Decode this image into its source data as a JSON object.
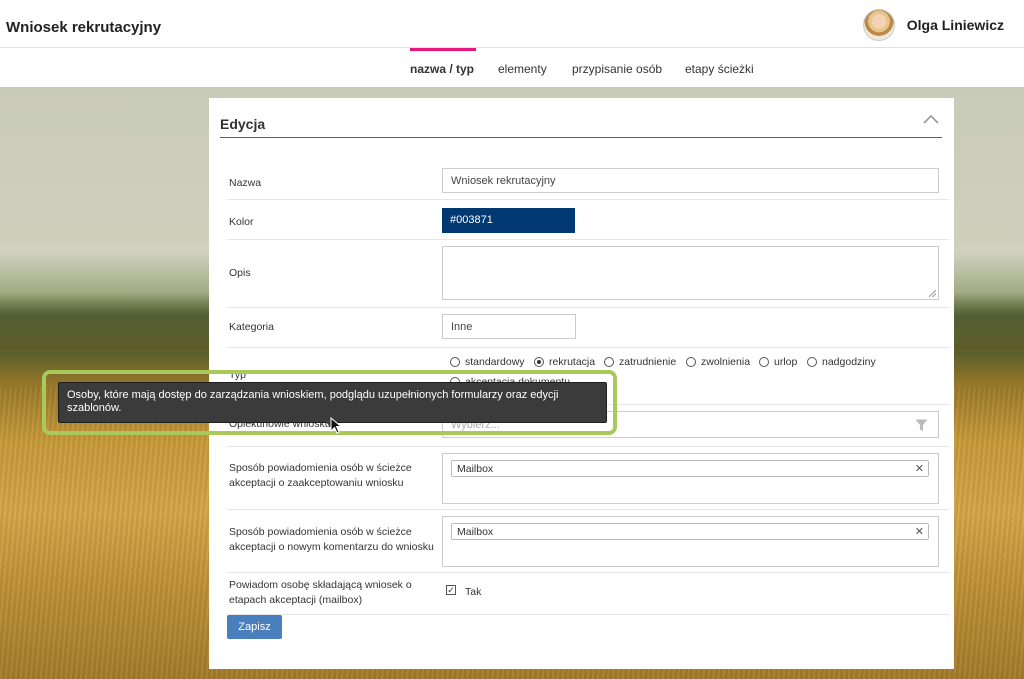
{
  "app": {
    "title": "Wniosek rekrutacyjny"
  },
  "user": {
    "name": "Olga Liniewicz"
  },
  "tabs": [
    {
      "label": "nazwa / typ",
      "active": true
    },
    {
      "label": "elementy",
      "active": false
    },
    {
      "label": "przypisanie osób",
      "active": false
    },
    {
      "label": "etapy ścieżki",
      "active": false
    }
  ],
  "card": {
    "title": "Edycja"
  },
  "form": {
    "name": {
      "label": "Nazwa",
      "value": "Wniosek rekrutacyjny"
    },
    "color": {
      "label": "Kolor",
      "value": "#003871"
    },
    "description": {
      "label": "Opis",
      "value": ""
    },
    "category": {
      "label": "Kategoria",
      "value": "Inne"
    },
    "type": {
      "label": "Typ",
      "options": [
        "standardowy",
        "rekrutacja",
        "zatrudnienie",
        "zwolnienia",
        "urlop",
        "nadgodziny",
        "akceptacja dokumentu"
      ],
      "selected": "rekrutacja"
    },
    "guardians": {
      "label": "Opiekunowie wniosku",
      "placeholder": "Wybierz..."
    },
    "notify_accept": {
      "label": "Sposób powiadomienia osób w ścieżce akceptacji o zaakceptowaniu wniosku",
      "tag": "Mailbox"
    },
    "notify_comment": {
      "label": "Sposób powiadomienia osób w ścieżce akceptacji o nowym komentarzu do wniosku",
      "tag": "Mailbox"
    },
    "notify_applicant": {
      "label": "Powiadom osobę składającą wniosek o etapach akceptacji (mailbox)",
      "checkbox_label": "Tak",
      "checked": true
    }
  },
  "actions": {
    "save_label": "Zapisz"
  },
  "tooltip": {
    "text": "Osoby, które mają dostęp do zarządzania wnioskiem, podglądu uzupełnionych formularzy oraz edycji szablonów."
  },
  "colors": {
    "accent": "#e5167d",
    "primary_button": "#4a7fbd",
    "highlight_frame": "#a9c95b"
  }
}
